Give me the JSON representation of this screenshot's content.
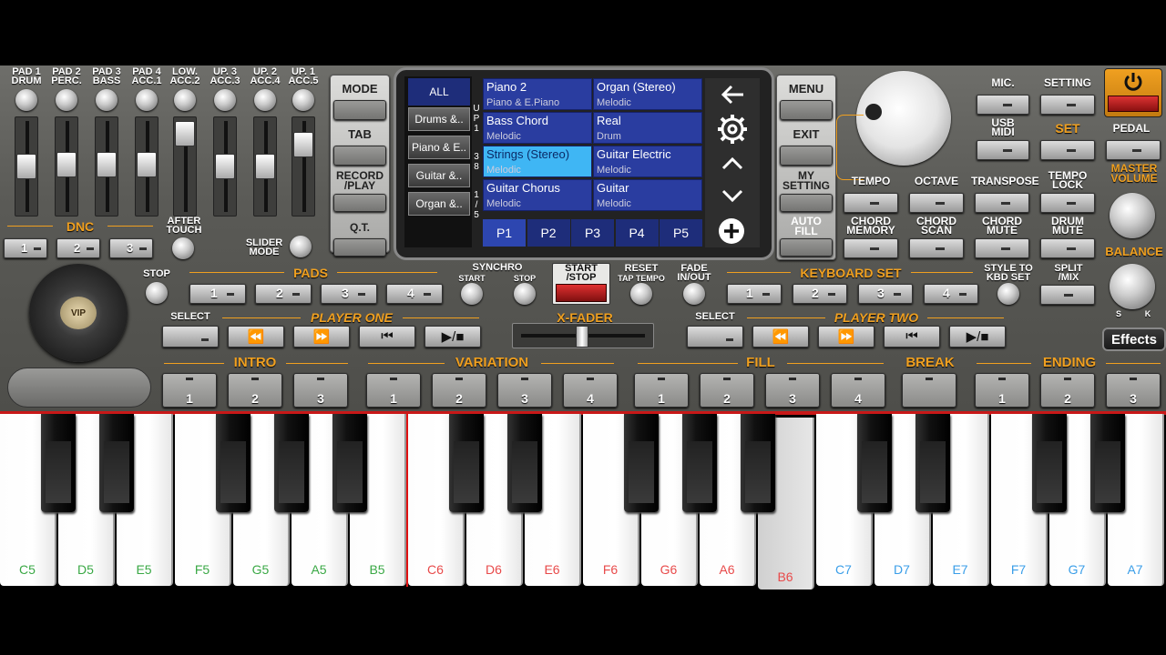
{
  "top_slots": [
    {
      "l1": "PAD 1",
      "l2": "DRUM"
    },
    {
      "l1": "PAD 2",
      "l2": "PERC."
    },
    {
      "l1": "PAD 3",
      "l2": "BASS"
    },
    {
      "l1": "PAD 4",
      "l2": "ACC.1"
    },
    {
      "l1": "LOW.",
      "l2": "ACC.2"
    },
    {
      "l1": "UP. 3",
      "l2": "ACC.3"
    },
    {
      "l1": "UP. 2",
      "l2": "ACC.4"
    },
    {
      "l1": "UP. 1",
      "l2": "ACC.5"
    }
  ],
  "dnc": {
    "title": "DNC",
    "b1": "1",
    "b2": "2",
    "b3": "3"
  },
  "after_touch": {
    "l1": "AFTER",
    "l2": "TOUCH"
  },
  "slider_mode": {
    "l1": "SLIDER",
    "l2": "MODE"
  },
  "left_col": {
    "mode": "MODE",
    "tab": "TAB",
    "rec1": "RECORD",
    "rec2": "/PLAY",
    "qt": "Q.T."
  },
  "screen": {
    "categories": [
      "ALL",
      "Drums &..",
      "Piano & E..",
      "Guitar &..",
      "Organ &.."
    ],
    "side_text": [
      "U",
      "P",
      "1",
      "3",
      "8",
      "1",
      "/",
      "5"
    ],
    "voices": [
      {
        "name": "Piano 2",
        "type": "Piano & E.Piano"
      },
      {
        "name": "Organ (Stereo)",
        "type": "Melodic"
      },
      {
        "name": "Bass Chord",
        "type": "Melodic"
      },
      {
        "name": "Real",
        "type": "Drum"
      },
      {
        "name": "Strings (Stereo)",
        "type": "Melodic"
      },
      {
        "name": "Guitar Electric",
        "type": "Melodic"
      },
      {
        "name": "Guitar Chorus",
        "type": "Melodic"
      },
      {
        "name": "Guitar",
        "type": "Melodic"
      }
    ],
    "pages": [
      "P1",
      "P2",
      "P3",
      "P4",
      "P5"
    ],
    "icons": {
      "back": "back-arrow-icon",
      "gear": "gear-icon",
      "up": "chevron-up-icon",
      "down": "chevron-down-icon",
      "add": "plus-circle-icon"
    }
  },
  "right_col": {
    "menu": "MENU",
    "exit": "EXIT",
    "my1": "MY",
    "my2": "SETTING",
    "af1": "AUTO",
    "af2": "FILL"
  },
  "right_panel": {
    "mic": "MIC.",
    "setting": "SETTING",
    "usb1": "USB",
    "usb2": "MIDI",
    "set": "SET",
    "pedal": "PEDAL",
    "tempo": "TEMPO",
    "octave": "OCTAVE",
    "transpose": "TRANSPOSE",
    "tl1": "TEMPO",
    "tl2": "LOCK",
    "cm1": "CHORD",
    "cm2": "MEMORY",
    "cs1": "CHORD",
    "cs2": "SCAN",
    "cmu1": "CHORD",
    "cmu2": "MUTE",
    "dm1": "DRUM",
    "dm2": "MUTE",
    "mv1": "MASTER",
    "mv2": "VOLUME",
    "balance": "BALANCE",
    "s": "S",
    "k": "K",
    "effects": "Effects"
  },
  "row2": {
    "stop": "STOP",
    "pads": "PADS",
    "p1": "1",
    "p2": "2",
    "p3": "3",
    "p4": "4",
    "synchro": "SYNCHRO",
    "start": "START",
    "stop2": "STOP",
    "ss1": "START",
    "ss2": "/STOP",
    "reset": "RESET",
    "tap": "TAP TEMPO",
    "fade1": "FADE",
    "fade2": "IN/OUT",
    "keyboard_set": "KEYBOARD SET",
    "k1": "1",
    "k2": "2",
    "k3": "3",
    "k4": "4",
    "stk1": "STYLE TO",
    "stk2": "KBD SET",
    "split1": "SPLIT",
    "split2": "/MIX"
  },
  "row3": {
    "select": "SELECT",
    "player_one": "PLAYER ONE",
    "xfader": "X-FADER",
    "select2": "SELECT",
    "player_two": "PLAYER TWO"
  },
  "row4": {
    "intro": "INTRO",
    "variation": "VARIATION",
    "fill": "FILL",
    "break": "BREAK",
    "ending": "ENDING",
    "intro_btns": [
      "1",
      "2",
      "3"
    ],
    "var_btns": [
      "1",
      "2",
      "3",
      "4"
    ],
    "fill_btns": [
      "1",
      "2",
      "3",
      "4"
    ],
    "end_btns": [
      "1",
      "2",
      "3"
    ]
  },
  "keys": [
    {
      "n": "C5",
      "c": "#3aa845"
    },
    {
      "n": "D5",
      "c": "#3aa845"
    },
    {
      "n": "E5",
      "c": "#3aa845"
    },
    {
      "n": "F5",
      "c": "#3aa845"
    },
    {
      "n": "G5",
      "c": "#3aa845"
    },
    {
      "n": "A5",
      "c": "#3aa845"
    },
    {
      "n": "B5",
      "c": "#3aa845"
    },
    {
      "n": "C6",
      "c": "#e84a4a"
    },
    {
      "n": "D6",
      "c": "#e84a4a"
    },
    {
      "n": "E6",
      "c": "#e84a4a"
    },
    {
      "n": "F6",
      "c": "#e84a4a"
    },
    {
      "n": "G6",
      "c": "#e84a4a"
    },
    {
      "n": "A6",
      "c": "#e84a4a"
    },
    {
      "n": "B6",
      "c": "#e84a4a"
    },
    {
      "n": "C7",
      "c": "#3a9ee8"
    },
    {
      "n": "D7",
      "c": "#3a9ee8"
    },
    {
      "n": "E7",
      "c": "#3a9ee8"
    },
    {
      "n": "F7",
      "c": "#3a9ee8"
    },
    {
      "n": "G7",
      "c": "#3a9ee8"
    },
    {
      "n": "A7",
      "c": "#3a9ee8"
    }
  ],
  "pressed_key": "B6",
  "logo": "VIP"
}
